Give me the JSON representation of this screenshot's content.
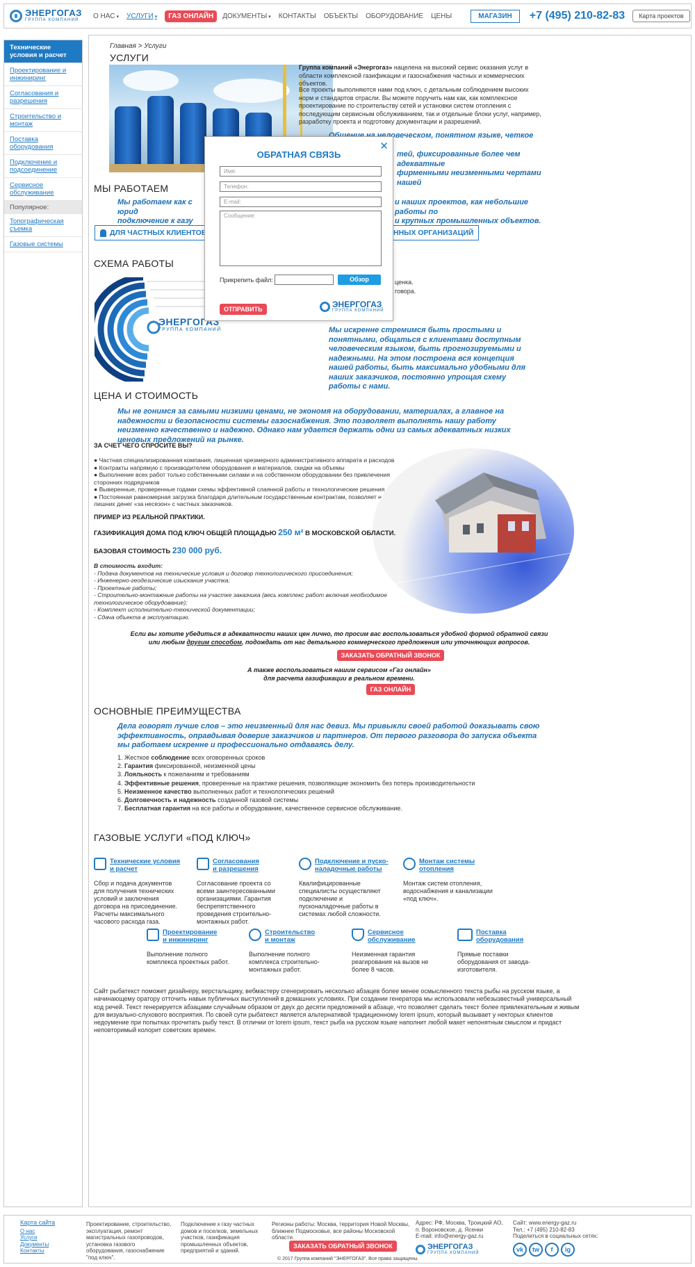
{
  "header": {
    "logo_title": "ЭНЕРГОГАЗ",
    "logo_subtitle": "ГРУППА КОМПАНИЙ",
    "nav": {
      "about": "О НАС",
      "services": "УСЛУГИ",
      "gas_online": "ГАЗ ОНЛАЙН",
      "documents": "ДОКУМЕНТЫ",
      "contacts": "КОНТАКТЫ",
      "objects": "ОБЪЕКТЫ",
      "equipment": "ОБОРУДОВАНИЕ",
      "prices": "ЦЕНЫ"
    },
    "shop": "МАГАЗИН",
    "phone": "+7 (495) 210-82-83",
    "map_button": "Карта проектов"
  },
  "sidebar": {
    "items": [
      "Технические условия и расчет",
      "Проектирование и инжиниринг",
      "Согласования и разрешения",
      "Строительство и монтаж",
      "Поставка оборудования",
      "Подключение и подсоединение",
      "Сервисное обслуживание"
    ],
    "popular_label": "Популярное:",
    "popular": [
      "Топографическая съемка",
      "Газовые системы"
    ]
  },
  "breadcrumb": {
    "home": "Главная",
    "sep": " > ",
    "current": "Услуги"
  },
  "services_section": {
    "title": "УСЛУГИ",
    "intro_bold": "Группа компаний «Энергогаз»",
    "intro_rest": " нацелена на высокий сервис оказания услуг в области комплексной газификации и газоснабжения частных и коммерческих объектов.",
    "para2": "Все проекты выполняются нами под ключ, с детальным соблюдением высоких норм и стандартов отрасли. Вы можете поручить нам как, как комплексное проектирование по строительству сетей и установки систем отопления с последующим сервисным обслуживанием, так и отдельные блоки услуг, например, разработку проекта и подготовку документации и разрешений.",
    "quote_lines": [
      "Общение на человеческом, понятном языке, четкое выполнение",
      "тей, фиксированные более чем адекватные",
      "фирменными неизменными чертами нашей"
    ]
  },
  "work_section": {
    "title": "МЫ РАБОТАЕМ",
    "quote_left": [
      "Мы работаем как с юрид",
      "подключение к газу дачн"
    ],
    "quote_right": [
      "и наших проектов, как небольшие работы по",
      "и крупных промышленных объектов."
    ],
    "btn_private": "ДЛЯ ЧАСТНЫХ КЛИЕНТОВ",
    "btn_org": "ННЫХ ОРГАНИЗАЦИЙ"
  },
  "scheme_section": {
    "title": "СХЕМА РАБОТЫ",
    "right_frag": [
      "ценка.",
      "говора."
    ],
    "quote": "Мы искренне стремимся быть простыми и понятными, общаться с клиентами доступным человеческим языком, быть прогнозируемыми и надежными. На этом построена вся концепция нашей работы, быть максимально удобными для наших заказчиков, постоянно упрощая схему работы с нами."
  },
  "modal": {
    "title": "ОБРАТНАЯ СВЯЗЬ",
    "close": "✕",
    "name_ph": "Имя:",
    "phone_ph": "Телефон:",
    "email_ph": "E-mail:",
    "message_ph": "Сообщение:",
    "attach_label": "Прикрепить файл:",
    "browse": "Обзор",
    "submit": "ОТПРАВИТЬ"
  },
  "price_section": {
    "title": "ЦЕНА И СТОИМОСТЬ",
    "quote": "Мы не гонимся за самыми низкими ценами, не экономя на оборудовании, материалах, а главное на надежности и безопасности системы газоснабжения. Это позволяет выполнять нашу работу неизменно качественно и надежно. Однако нам удается держать одни из самых адекватных низких ценовых предложений на рынке.",
    "why_title": "ЗА СЧЕТ ЧЕГО СПРОСИТЕ ВЫ?",
    "why_items": [
      "● Частная специализированная компания, лишенная чрезмерного административного аппарата и расходов",
      "● Контракты напрямую с производителем оборудования и материалов, скидки на объемы",
      "● Выполнение всех работ только собственными силами и на собственном оборудовании без привлечения сторонних подрядчиков",
      "● Выверенные, проверенные годами схемы эффективной слаянной работы и технологические решения",
      "● Постоянная равномерная загрузка благодаря длительным государственным контрактам, позволяет не брать лишних денег «за несезон» с частных заказчиков."
    ],
    "example_title": "ПРИМЕР ИЗ РЕАЛЬНОЙ ПРАКТИКИ.",
    "example_line_a": "ГАЗИФИКАЦИЯ ДОМА ПОД КЛЮЧ ОБЩЕЙ ПЛОЩАДЬЮ ",
    "example_area": "250 м²",
    "example_line_b": " В МОСКОВСКОЙ ОБЛАСТИ.",
    "base_label": "БАЗОВАЯ СТОИМОСТЬ ",
    "base_value": "230 000 руб.",
    "includes_title": "В стоимость входит:",
    "includes": [
      "- Подача документов на технические условия и договор технологического присоединения;",
      "- Инженерно-геодезические изыскания участка;",
      "- Проектные работы;",
      "- Строительно-монтажные работы на участке заказчика (весь комплекс работ включая необходимое технологическое оборудование);",
      "- Комплект исполнительно-технической документации;",
      "- Сдача объекта в эксплуатацию."
    ],
    "cta_text_a": "Если вы хотите убедиться в адекватности наших цен лично, то просим вас воспользоваться удобной формой обратной связи",
    "cta_text_b1": "или любым ",
    "cta_text_link": "другим способом",
    "cta_text_b2": ", подождать от нас детального коммерческого предложения или уточняющих вопросов.",
    "cta_button": "ЗАКАЗАТЬ ОБРАТНЫЙ ЗВОНОК",
    "online_a": "А также воспользоваться нашим сервисом «Газ онлайн»",
    "online_b": "для расчета газификации в реальном времени.",
    "online_button": "ГАЗ ОНЛАЙН"
  },
  "advantages": {
    "title": "ОСНОВНЫЕ ПРЕИМУЩЕСТВА",
    "quote": "Дела говорят лучше слов – это неизменный для нас девиз. Мы привыкли своей работой доказывать свою эффективность, оправдывая доверие заказчиков и партнеров. От первого разговора до запуска объекта мы работаем искренне и профессионально отдаваясь делу.",
    "items": [
      {
        "n": "1. Жесткое ",
        "b": "соблюдение",
        "r": " всех оговоренных сроков"
      },
      {
        "n": "2. ",
        "b": "Гарантия",
        "r": " фиксированной, неизменной цены"
      },
      {
        "n": "3. ",
        "b": "Лояльность",
        "r": " к пожеланиям и требованиям"
      },
      {
        "n": "4. ",
        "b": "Эффективные решения",
        "r": ", проверенные на практике решения, позволяющие экономить без потерь производительности"
      },
      {
        "n": "5. ",
        "b": "Неизменное качество",
        "r": " выполненных работ и технологических решений"
      },
      {
        "n": "6. ",
        "b": "Долговечность и надежность",
        "r": " созданной газовой системы"
      },
      {
        "n": "7. ",
        "b": "Бесплатная гарантия",
        "r": " на все работы и оборудование, качественное сервисное обслуживание."
      }
    ]
  },
  "turnkey": {
    "title": "ГАЗОВЫЕ УСЛУГИ «ПОД КЛЮЧ»",
    "items": [
      {
        "t1": "Технические условия",
        "t2": "и расчет",
        "d": "Сбор и подача документов для получения технических условий и заключения договора на присоединение. Расчеты максимального часового расхода газа.",
        "icon": "checklist-icon"
      },
      {
        "t1": "Согласования",
        "t2": "и разрешения",
        "d": "Согласование проекта со всеми заинтересованными организациями. Гарантия беспрепятственного проведения строительно-монтажных работ.",
        "icon": "document-icon"
      },
      {
        "t1": "Подключение и пуско-",
        "t2": "наладочные работы",
        "d": "Квалифицированные специалисты осуществляют подключение и пусконаладочные работы в системах любой сложности.",
        "icon": "plus-circle-icon"
      },
      {
        "t1": "Монтаж системы",
        "t2": "отопления",
        "d": "Монтаж систем отопления, водоснабжения и канализации «под ключ».",
        "icon": "gear-icon"
      },
      {
        "t1": "Проектирование",
        "t2": "и инжиниринг",
        "d": "Выполнение полного комплекса проектных работ.",
        "icon": "ruler-icon"
      },
      {
        "t1": "Строительство",
        "t2": "и монтаж",
        "d": "Выполнение полного комплекса строительно-монтажных работ.",
        "icon": "helmet-icon"
      },
      {
        "t1": "Сервисное",
        "t2": "обслуживание",
        "d": "Неизменная гарантия реагирования на вызов не более 8 часов.",
        "icon": "shield-icon"
      },
      {
        "t1": "Поставка",
        "t2": "оборудования",
        "d": "Прямые поставки оборудования от завода-изготовителя.",
        "icon": "truck-icon"
      }
    ],
    "seo_text": "Сайт рыбатекст поможет дизайнеру, верстальщику, вебмастеру сгенерировать несколько абзацев более менее осмысленного текста рыбы на русском языке, а начинающему оратору отточить навык публичных выступлений в домашних условиях. При создании генератора мы использовали небезызвестный универсальный код речей. Текст генерируется абзацами случайным образом от двух до десяти предложений в абзаце, что позволяет сделать текст более привлекательным и живым для визуально-слухового восприятия. По своей сути рыбатекст является альтернативой традиционному lorem ipsum, который вызывает у некторых клиентов недоумение при попытках прочитать рыбу текст. В отличии от lorem ipsum, текст рыба на русском языке наполнит любой макет непонятным смыслом и придаст неповторимый колорит советских времен."
  },
  "footer": {
    "sitemap_title": "Карта сайта",
    "sitemap": [
      "О нас",
      "Услуги",
      "Документы",
      "Контакты"
    ],
    "col2": "Проектирование, строительство, эксплуатация, ремонт магистральных газопроводов, установка газового оборудования, газоснабжение \"под ключ\".",
    "col3": "Подключение к газу частных домов и поселков, земельных участков, газификация промышленных объектов, предприятий и зданий.",
    "regions": "Регионы работы: Москва, территория Новой Москвы, ближнее Подмосковье, все районы Московской области.",
    "callback": "ЗАКАЗАТЬ ОБРАТНЫЙ ЗВОНОК",
    "copyright": "© 2017 Группа компаний \"ЭНЕРГОГАЗ\". Все права защищены.",
    "address": "Адрес: РФ, Москва, Троицкий АО, п. Вороновское, д. Ясенки",
    "email": "E-mail: info@energy-gaz.ru",
    "site": "Сайт: www.energy-gaz.ru",
    "tel": "Тел.: +7 (495) 210-82-83",
    "share": "Поделиться в социальных сетях:",
    "social": [
      "vk",
      "tw",
      "f",
      "ig"
    ]
  },
  "colors": {
    "accent": "#1f7ac4",
    "red": "#ea4a56",
    "quote": "#1d6fb4"
  }
}
